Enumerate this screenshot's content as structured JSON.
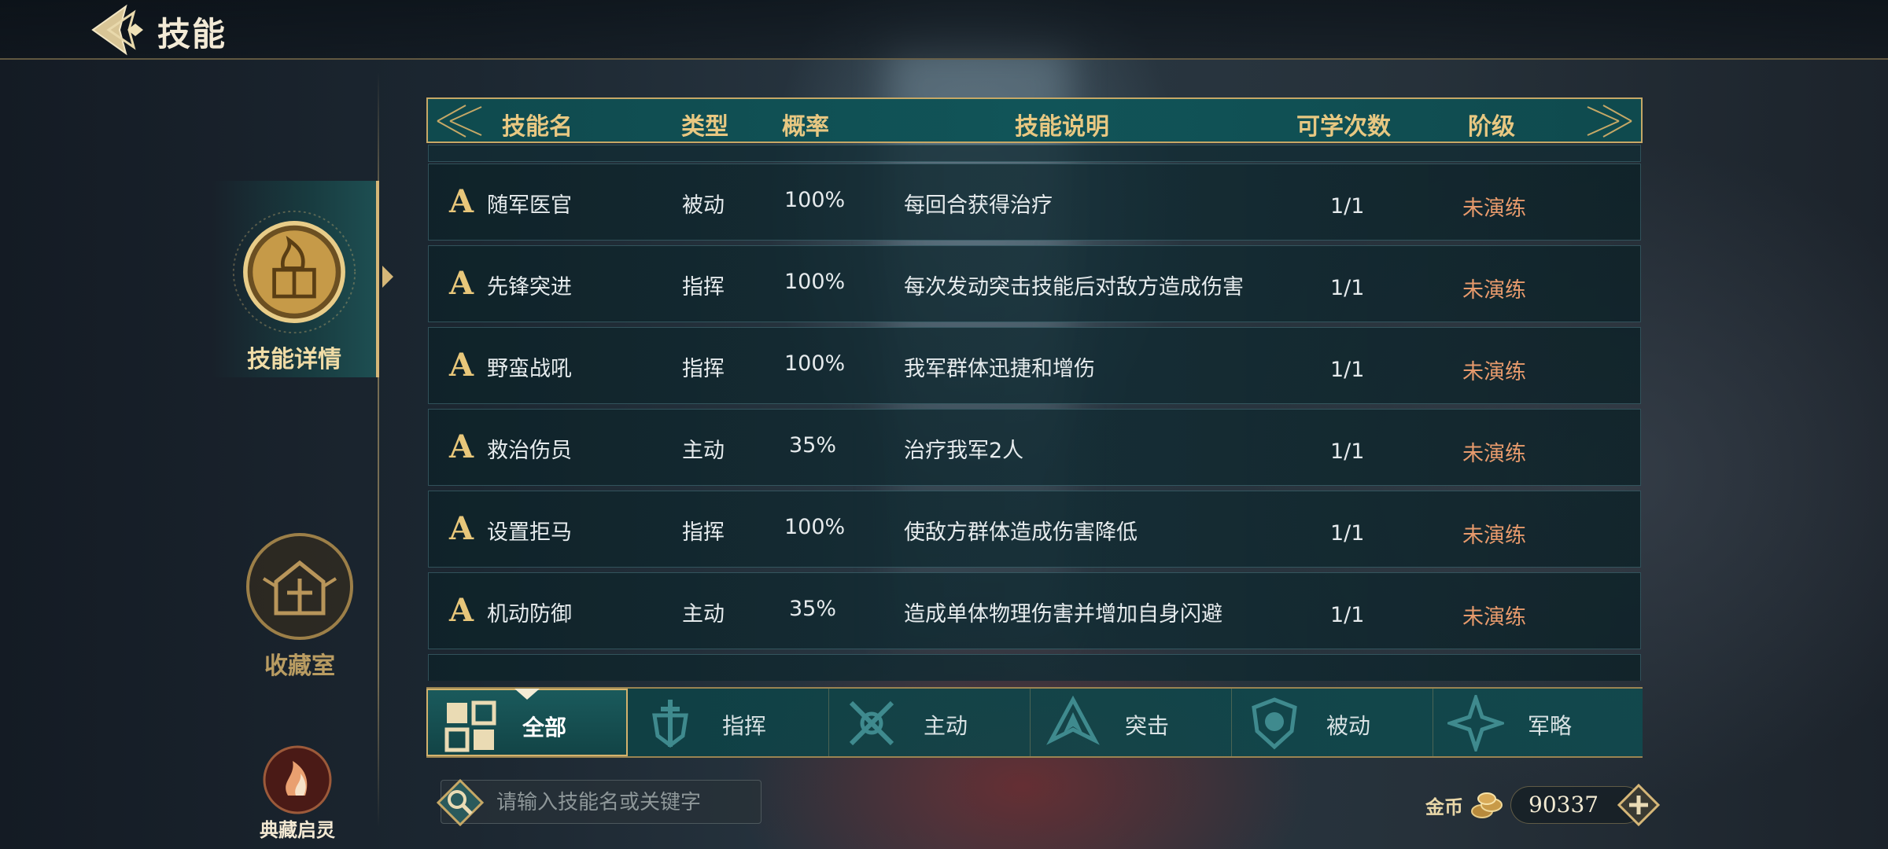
{
  "header": {
    "title": "技能"
  },
  "nav": [
    {
      "label": "技能详情",
      "active": true,
      "icon": "flame-book-emblem-icon"
    },
    {
      "label": "收藏室",
      "active": false,
      "icon": "shrine-emblem-icon"
    },
    {
      "label": "典藏启灵",
      "active": false,
      "icon": "spirit-flame-icon"
    }
  ],
  "table": {
    "columns": [
      "技能名",
      "类型",
      "概率",
      "技能说明",
      "可学次数",
      "阶级"
    ],
    "rows": [
      {
        "grade": "A",
        "name": "随军医官",
        "type": "被动",
        "rate": "100%",
        "desc": "每回合获得治疗",
        "count": "1/1",
        "stage": "未演练"
      },
      {
        "grade": "A",
        "name": "先锋突进",
        "type": "指挥",
        "rate": "100%",
        "desc": "每次发动突击技能后对敌方造成伤害",
        "count": "1/1",
        "stage": "未演练"
      },
      {
        "grade": "A",
        "name": "野蛮战吼",
        "type": "指挥",
        "rate": "100%",
        "desc": "我军群体迅捷和增伤",
        "count": "1/1",
        "stage": "未演练"
      },
      {
        "grade": "A",
        "name": "救治伤员",
        "type": "主动",
        "rate": "35%",
        "desc": "治疗我军2人",
        "count": "1/1",
        "stage": "未演练"
      },
      {
        "grade": "A",
        "name": "设置拒马",
        "type": "指挥",
        "rate": "100%",
        "desc": "使敌方群体造成伤害降低",
        "count": "1/1",
        "stage": "未演练"
      },
      {
        "grade": "A",
        "name": "机动防御",
        "type": "主动",
        "rate": "35%",
        "desc": "造成单体物理伤害并增加自身闪避",
        "count": "1/1",
        "stage": "未演练"
      }
    ]
  },
  "filters": [
    {
      "label": "全部",
      "icon": "grid-icon",
      "active": true
    },
    {
      "label": "指挥",
      "icon": "sword-shield-icon",
      "active": false
    },
    {
      "label": "主动",
      "icon": "crossed-weapons-icon",
      "active": false
    },
    {
      "label": "突击",
      "icon": "spearhead-icon",
      "active": false
    },
    {
      "label": "被动",
      "icon": "shield-icon",
      "active": false
    },
    {
      "label": "军略",
      "icon": "compass-star-icon",
      "active": false
    }
  ],
  "search": {
    "placeholder": "请输入技能名或关键字"
  },
  "currency": {
    "label": "金币",
    "value": "90337",
    "icon": "coins-icon"
  },
  "colors": {
    "gold": "#d6b778",
    "teal": "#115458",
    "stage": "#e79a6c"
  }
}
